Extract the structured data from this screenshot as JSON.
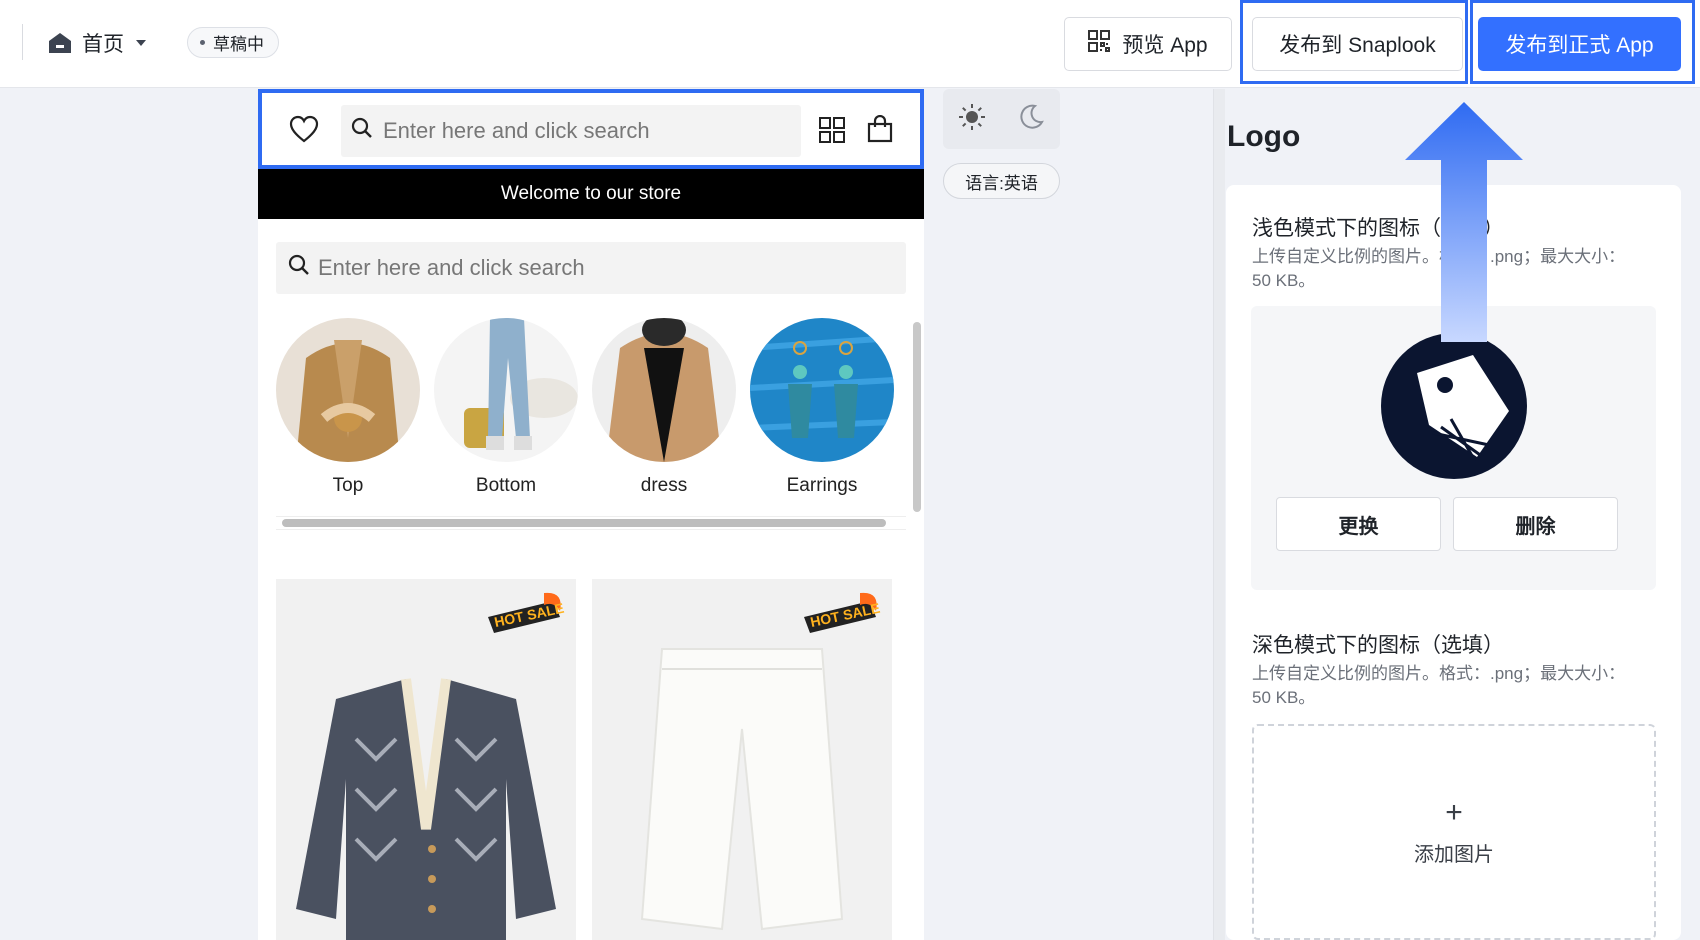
{
  "topbar": {
    "home_label": "首页",
    "status_badge": "草稿中",
    "preview_button": "预览 App",
    "publish_snaplook_button": "发布到 Snaplook",
    "publish_app_button": "发布到正式 App"
  },
  "preview": {
    "search_placeholder": "Enter here and click search",
    "banner_text": "Welcome to our store",
    "body_search_placeholder": "Enter here and click search",
    "categories": [
      {
        "label": "Top"
      },
      {
        "label": "Bottom"
      },
      {
        "label": "dress"
      },
      {
        "label": "Earrings"
      }
    ],
    "hot_badge": "HOT SALE"
  },
  "theme": {
    "language_chip": "语言:英语"
  },
  "panel": {
    "title": "Logo",
    "light_icon": {
      "title": "浅色模式下的图标（必填）",
      "desc": "上传自定义比例的图片。格式：.png；最大大小：50 KB。"
    },
    "replace_button": "更换",
    "delete_button": "删除",
    "dark_icon": {
      "title": "深色模式下的图标（选填）",
      "desc": "上传自定义比例的图片。格式：.png；最大大小：50 KB。"
    },
    "add_image_plus": "+",
    "add_image_label": "添加图片"
  },
  "colors": {
    "accent": "#3370ff",
    "highlight": "#2f6bf2",
    "logo_dark": "#0b1530"
  }
}
